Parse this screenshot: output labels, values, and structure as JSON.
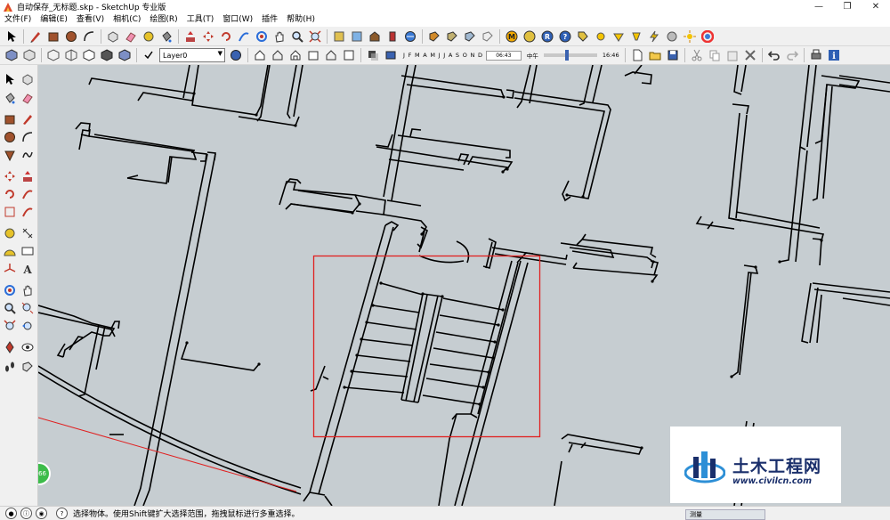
{
  "window": {
    "title": "自动保存_无标题.skp - SketchUp 专业版",
    "minimize_glyph": "—",
    "maximize_glyph": "❐",
    "close_glyph": "✕"
  },
  "menubar": {
    "items": [
      "文件(F)",
      "编辑(E)",
      "查看(V)",
      "相机(C)",
      "绘图(R)",
      "工具(T)",
      "窗口(W)",
      "插件",
      "帮助(H)"
    ]
  },
  "toolbar": {
    "layer_value": "Layer0",
    "shadow_months": "J F M A M J J A S O N D",
    "shadow_time_start": "06:43",
    "shadow_noon": "中午",
    "shadow_time_end": "16:46"
  },
  "badge": {
    "text": "66"
  },
  "statusbar": {
    "message": "选择物体。使用Shift键扩大选择范围，拖拽鼠标进行多重选择。",
    "peek_text": "测量"
  },
  "watermark": {
    "title": "土木工程网",
    "url": "www.civilcn.com"
  },
  "colors": {
    "viewport_bg": "#c6cdd1",
    "line": "#000000",
    "highlight_box": "#e02020",
    "watermark_text": "#1a2f6b"
  },
  "icons": {
    "select": "select-arrow-icon",
    "pencil": "pencil-icon",
    "rectangle": "rectangle-icon",
    "circle": "circle-icon",
    "arc": "arc-icon",
    "eraser": "eraser-icon",
    "paint": "paint-bucket-icon",
    "orbit": "orbit-icon",
    "pan": "pan-hand-icon",
    "zoom": "zoom-icon",
    "zoom_extents": "zoom-extents-icon",
    "undo": "undo-icon",
    "redo": "redo-icon",
    "print": "print-icon",
    "info": "info-icon",
    "walk": "footprints-icon"
  }
}
